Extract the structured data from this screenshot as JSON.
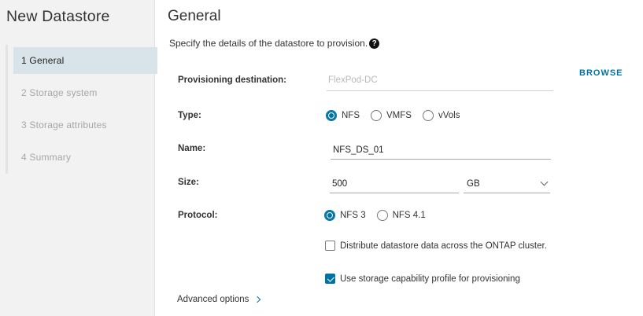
{
  "sidebar": {
    "title": "New Datastore",
    "steps": [
      {
        "label": "1 General",
        "state": "active"
      },
      {
        "label": "2 Storage system",
        "state": "pending"
      },
      {
        "label": "3 Storage attributes",
        "state": "pending"
      },
      {
        "label": "4 Summary",
        "state": "pending"
      }
    ]
  },
  "main": {
    "title": "General",
    "subtitle": "Specify the details of the datastore to provision.",
    "help_icon": "?",
    "browse_label": "BROWSE",
    "fields": {
      "destination": {
        "label": "Provisioning destination:",
        "placeholder": "FlexPod-DC"
      },
      "type": {
        "label": "Type:",
        "options": [
          "NFS",
          "VMFS",
          "vVols"
        ],
        "selected": "NFS"
      },
      "name": {
        "label": "Name:",
        "value": "NFS_DS_01"
      },
      "size": {
        "label": "Size:",
        "value": "500",
        "unit": "GB"
      },
      "protocol": {
        "label": "Protocol:",
        "options": [
          "NFS 3",
          "NFS 4.1"
        ],
        "selected": "NFS 3"
      }
    },
    "checkboxes": {
      "distribute": {
        "label": "Distribute datastore data across the ONTAP cluster.",
        "checked": false
      },
      "capability_profile": {
        "label": "Use storage capability profile for provisioning",
        "checked": true
      }
    },
    "advanced_label": "Advanced options"
  },
  "colors": {
    "accent": "#0072a3",
    "sidebar_bg": "#f2f2f2",
    "active_step_bg": "#d9e4ea"
  }
}
